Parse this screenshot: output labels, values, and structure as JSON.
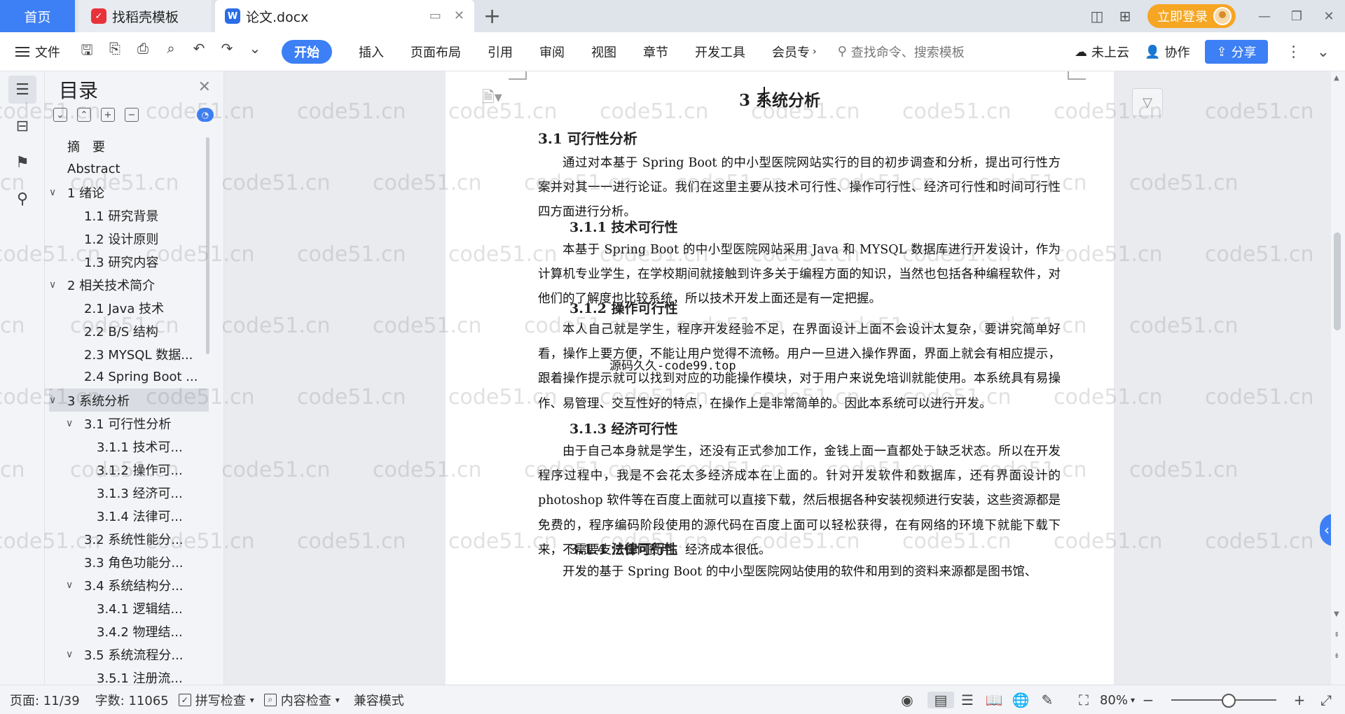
{
  "titlebar": {
    "home_tab": "首页",
    "template_tab": "找稻壳模板",
    "doc_tab": "论文.docx",
    "login_label": "立即登录"
  },
  "ribbon": {
    "file_label": "文件",
    "tabs": [
      "开始",
      "插入",
      "页面布局",
      "引用",
      "审阅",
      "视图",
      "章节",
      "开发工具",
      "会员专"
    ],
    "search_placeholder": "查找命令、搜索模板",
    "cloud_label": "未上云",
    "collab_label": "协作",
    "share_label": "分享"
  },
  "toc": {
    "title": "目录",
    "items": [
      {
        "label": "摘　要",
        "level": 0,
        "arrow": ""
      },
      {
        "label": "Abstract",
        "level": 0,
        "arrow": ""
      },
      {
        "label": "1  绪论",
        "level": 0,
        "arrow": "∨"
      },
      {
        "label": "1.1 研究背景",
        "level": 1,
        "arrow": ""
      },
      {
        "label": "1.2 设计原则",
        "level": 1,
        "arrow": ""
      },
      {
        "label": "1.3 研究内容",
        "level": 1,
        "arrow": ""
      },
      {
        "label": "2  相关技术简介",
        "level": 0,
        "arrow": "∨"
      },
      {
        "label": "2.1 Java 技术",
        "level": 1,
        "arrow": ""
      },
      {
        "label": "2.2 B/S 结构",
        "level": 1,
        "arrow": ""
      },
      {
        "label": "2.3 MYSQL 数据...",
        "level": 1,
        "arrow": ""
      },
      {
        "label": "2.4 Spring Boot ...",
        "level": 1,
        "arrow": ""
      },
      {
        "label": "3  系统分析",
        "level": 0,
        "arrow": "∨",
        "selected": true
      },
      {
        "label": "3.1  可行性分析",
        "level": 1,
        "arrow": "∨"
      },
      {
        "label": "3.1.1  技术可...",
        "level": 2,
        "arrow": ""
      },
      {
        "label": "3.1.2  操作可...",
        "level": 2,
        "arrow": ""
      },
      {
        "label": "3.1.3  经济可...",
        "level": 2,
        "arrow": ""
      },
      {
        "label": "3.1.4  法律可...",
        "level": 2,
        "arrow": ""
      },
      {
        "label": "3.2  系统性能分...",
        "level": 1,
        "arrow": ""
      },
      {
        "label": "3.3  角色功能分...",
        "level": 1,
        "arrow": ""
      },
      {
        "label": "3.4  系统结构分...",
        "level": 1,
        "arrow": "∨"
      },
      {
        "label": "3.4.1 逻辑结...",
        "level": 2,
        "arrow": ""
      },
      {
        "label": "3.4.2 物理结...",
        "level": 2,
        "arrow": ""
      },
      {
        "label": "3.5  系统流程分...",
        "level": 1,
        "arrow": "∨"
      },
      {
        "label": "3.5.1 注册流...",
        "level": 2,
        "arrow": ""
      }
    ]
  },
  "document": {
    "heading1": "3  系统分析",
    "heading2": "3.1  可行性分析",
    "intro": "通过对本基于 Spring Boot 的中小型医院网站实行的目的初步调查和分析，提出可行性方案并对其一一进行论证。我们在这里主要从技术可行性、操作可行性、经济可行性和时间可行性四方面进行分析。",
    "tech_title": "3.1.1  技术可行性",
    "tech_text": "本基于 Spring Boot 的中小型医院网站采用 Java 和 MYSQL 数据库进行开发设计，作为计算机专业学生，在学校期间就接触到许多关于编程方面的知识，当然也包括各种编程软件，对他们的了解度也比较系统，所以技术开发上面还是有一定把握。",
    "op_title": "3.1.2  操作可行性",
    "op_text": "本人自己就是学生，程序开发经验不足，在界面设计上面不会设计太复杂，要讲究简单好看，操作上要方便，不能让用户觉得不流畅。用户一旦进入操作界面，界面上就会有相应提示，跟着操作提示就可以找到对应的功能操作模块，对于用户来说免培训就能使用。本系统具有易操作、易管理、交互性好的特点，在操作上是非常简单的。因此本系统可以进行开发。",
    "eco_title": "3.1.3  经济可行性",
    "eco_text": "由于自己本身就是学生，还没有正式参加工作，金钱上面一直都处于缺乏状态。所以在开发程序过程中，我是不会花太多经济成本在上面的。针对开发软件和数据库，还有界面设计的 photoshop 软件等在百度上面就可以直接下载，然后根据各种安装视频进行安装，这些资源都是免费的，程序编码阶段使用的源代码在百度上面可以轻松获得，在有网络的环境下就能下载下来，不需要支付任何费用，经济成本很低。",
    "law_title": "3.1.4  法律可行性",
    "law_text": "开发的基于 Spring Boot 的中小型医院网站使用的软件和用到的资料来源都是图书馆、",
    "overlay": "源码久久-code99.top"
  },
  "watermark": "code51.cn",
  "statusbar": {
    "page": "页面: 11/39",
    "words": "字数: 11065",
    "spell": "拼写检查",
    "content_check": "内容检查",
    "compat": "兼容模式",
    "zoom": "80%"
  },
  "colors": {
    "accent": "#3d7ff5",
    "login": "#f6a623"
  }
}
